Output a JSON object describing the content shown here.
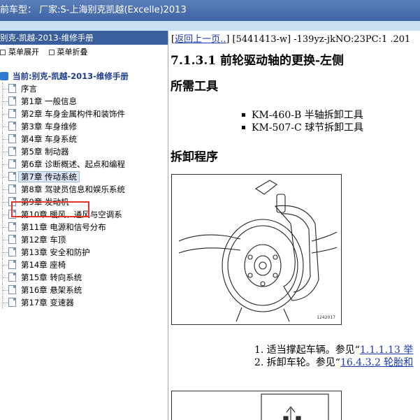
{
  "window": {
    "title": "前车型：  厂家:S-上海别克凯越(Excelle)2013"
  },
  "left": {
    "header": "别克-凯越-2013-维修手册",
    "toolbar": {
      "expand": "菜单展开",
      "collapse": "菜单折叠"
    },
    "tree_root": "当前:别克-凯越-2013-维修手册",
    "items": [
      "序言",
      "第1章 一般信息",
      "第2章 车身金属构件和装饰件",
      "第3章 车身维修",
      "第4章 车身系统",
      "第5章 制动器",
      "第6章 诊断概述、起点和编程",
      "第7章 传动系统",
      "第8章 驾驶员信息和娱乐系统",
      "第9章 发动机",
      "第10章 暖风、通风与空调系",
      "第11章 电源和信号分布",
      "第12章 车顶",
      "第13章 安全和防护",
      "第14章 座椅",
      "第15章 转向系统",
      "第16章 悬架系统",
      "第17章 变速器"
    ],
    "selected_index": 7
  },
  "content": {
    "nav_link": "返回上一页..",
    "nav_text": "] [5441413-w] -139yz-jkNO:23PC:1 .201",
    "title": "7.1.3.1 前轮驱动轴的更换-左侧",
    "tools_heading": "所需工具",
    "tools": [
      "KM-460-B 半轴拆卸工具",
      "KM-507-C 球节拆卸工具"
    ],
    "procedure_heading": "拆卸程序",
    "figure_number": "1242017",
    "steps": [
      {
        "prefix": "1. 适当撑起车辆。参见“",
        "link": "1.1.1.13 举"
      },
      {
        "prefix": "2. 拆卸车轮。参见“",
        "link": "16.4.3.2 轮胎和"
      }
    ]
  },
  "colors": {
    "titlebar": "#4a6fae",
    "selection_box": "#e0332a",
    "link": "#1a3bb0"
  }
}
